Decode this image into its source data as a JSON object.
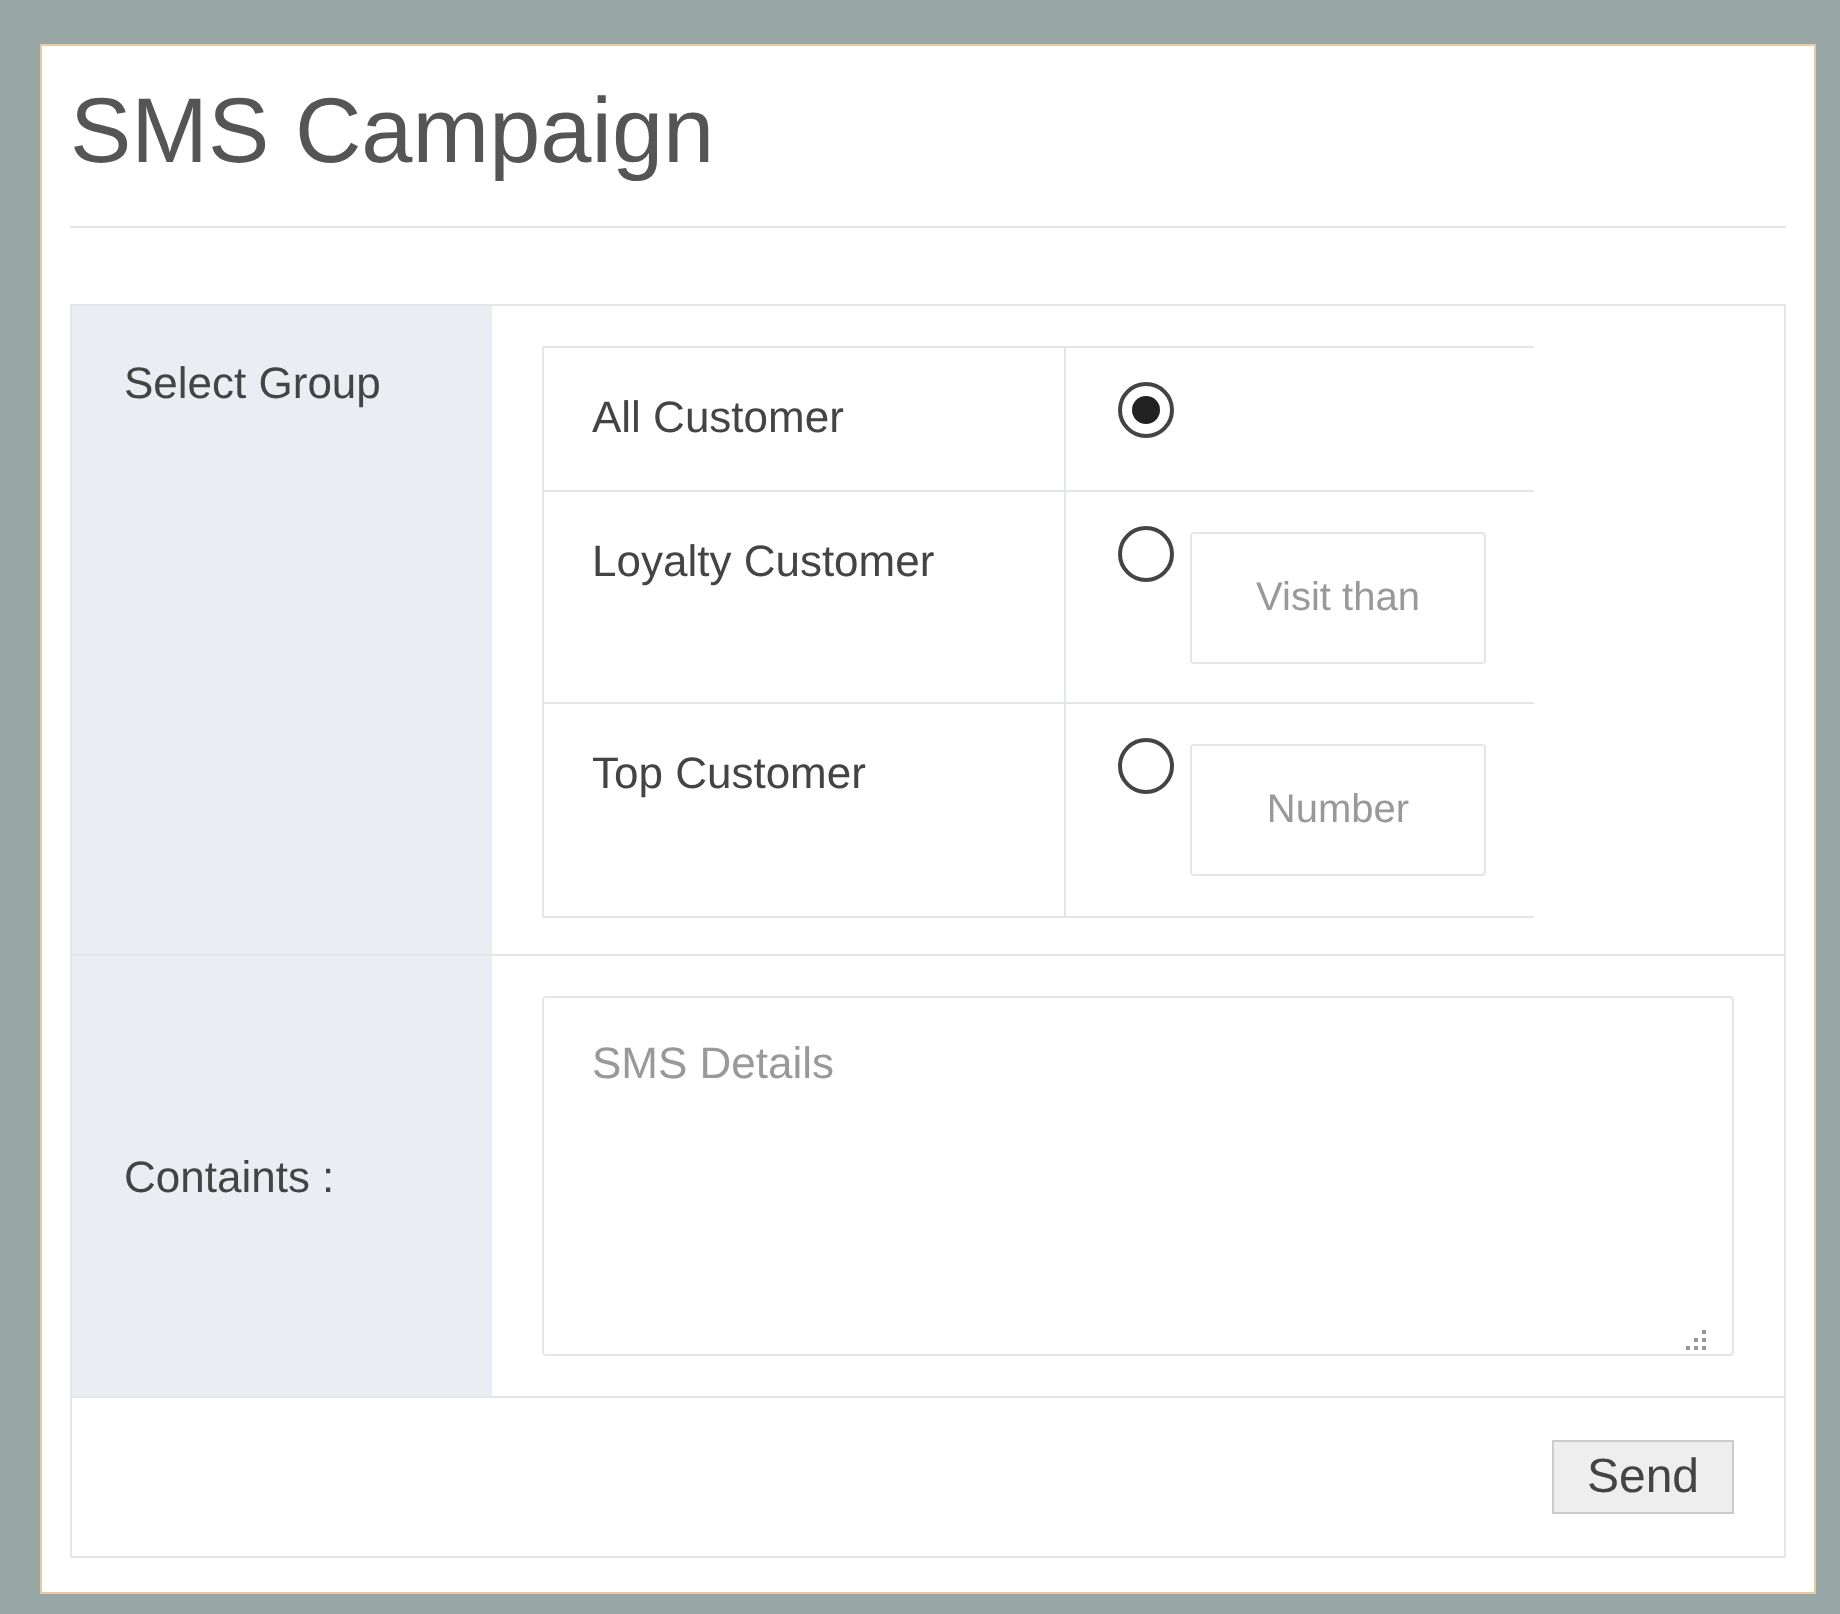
{
  "title": "SMS Campaign",
  "form": {
    "group_label": "Select Group",
    "groups": [
      {
        "label": "All Customer",
        "selected": true
      },
      {
        "label": "Loyalty Customer",
        "selected": false,
        "placeholder": "Visit than"
      },
      {
        "label": "Top Customer",
        "selected": false,
        "placeholder": "Number"
      }
    ],
    "contents_label": "Containts :",
    "sms_placeholder": "SMS Details"
  },
  "send_button": "Send"
}
